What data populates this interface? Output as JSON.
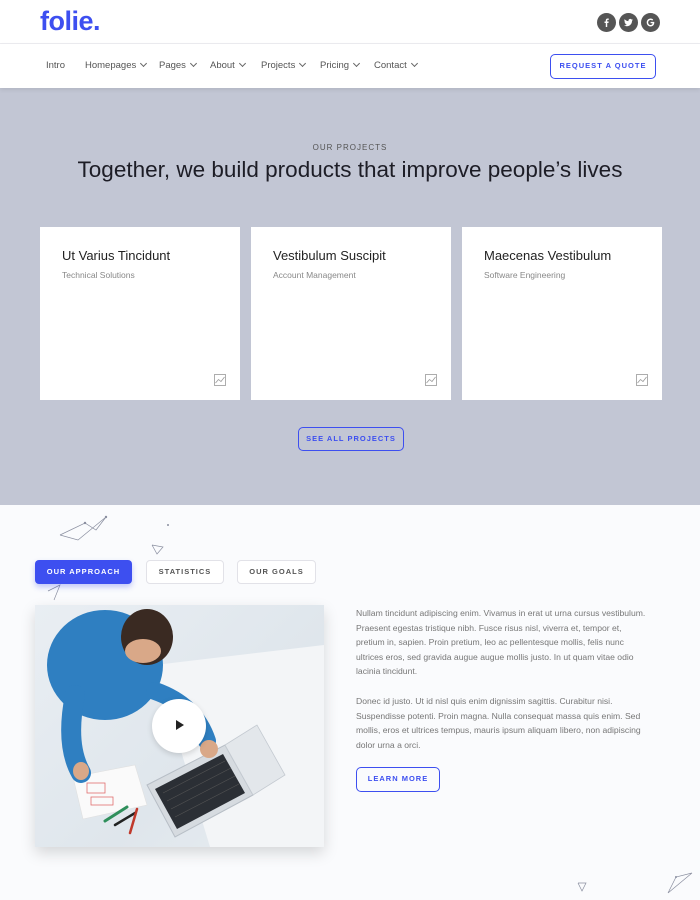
{
  "brand": {
    "logo": "folie.",
    "accent": "#3d4ff0"
  },
  "social": [
    {
      "icon": "facebook-icon",
      "glyph": "f"
    },
    {
      "icon": "twitter-icon",
      "glyph": "t"
    },
    {
      "icon": "google-icon",
      "glyph": "G"
    }
  ],
  "nav": {
    "items": [
      {
        "label": "Intro",
        "dropdown": false
      },
      {
        "label": "Homepages",
        "dropdown": true
      },
      {
        "label": "Pages",
        "dropdown": true
      },
      {
        "label": "About",
        "dropdown": true
      },
      {
        "label": "Projects",
        "dropdown": true
      },
      {
        "label": "Pricing",
        "dropdown": true
      },
      {
        "label": "Contact",
        "dropdown": true
      }
    ],
    "cta": "REQUEST A QUOTE"
  },
  "projects": {
    "eyebrow": "OUR PROJECTS",
    "headline": "Together, we build products that improve people’s lives",
    "cards": [
      {
        "title": "Ut Varius Tincidunt",
        "subtitle": "Technical Solutions"
      },
      {
        "title": "Vestibulum Suscipit",
        "subtitle": "Account Management"
      },
      {
        "title": "Maecenas Vestibulum",
        "subtitle": "Software Engineering"
      }
    ],
    "see_all": "SEE ALL PROJECTS"
  },
  "approach": {
    "tabs": [
      {
        "label": "OUR APPROACH",
        "active": true
      },
      {
        "label": "STATISTICS",
        "active": false
      },
      {
        "label": "OUR GOALS",
        "active": false
      }
    ],
    "paragraphs": [
      "Nullam tincidunt adipiscing enim. Vivamus in erat ut urna cursus vestibulum. Praesent egestas tristique nibh. Fusce risus nisl, viverra et, tempor et, pretium in, sapien. Proin pretium, leo ac pellentesque mollis, felis nunc ultrices eros, sed gravida augue augue mollis justo. In ut quam vitae odio lacinia tincidunt.",
      "Donec id justo. Ut id nisl quis enim dignissim sagittis. Curabitur nisi. Suspendisse potenti. Proin magna. Nulla consequat massa quis enim. Sed mollis, eros et ultrices tempus, mauris ipsum aliquam libero, non adipiscing dolor urna a orci."
    ],
    "learn_more": "LEARN MORE"
  }
}
